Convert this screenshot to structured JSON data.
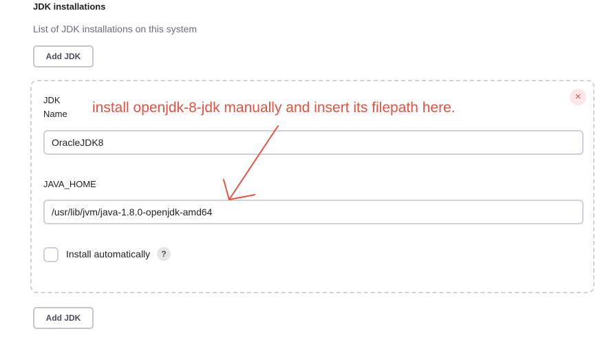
{
  "section": {
    "title": "JDK installations",
    "description": "List of JDK installations on this system"
  },
  "buttons": {
    "add_jdk_top": "Add JDK",
    "add_jdk_bottom": "Add JDK"
  },
  "jdk_entry": {
    "close_icon": "×",
    "name_label": "JDK Name",
    "name_value": "OracleJDK8",
    "java_home_label": "JAVA_HOME",
    "java_home_value": "/usr/lib/jvm/java-1.8.0-openjdk-amd64",
    "install_auto_label": "Install automatically",
    "install_auto_checked": false,
    "help_icon": "?"
  },
  "annotation": {
    "text": "install openjdk-8-jdk manually and insert its filepath here.",
    "color": "#e8503f"
  },
  "icons": {
    "close": "close-icon",
    "help": "help-icon",
    "arrow": "arrow-icon"
  }
}
